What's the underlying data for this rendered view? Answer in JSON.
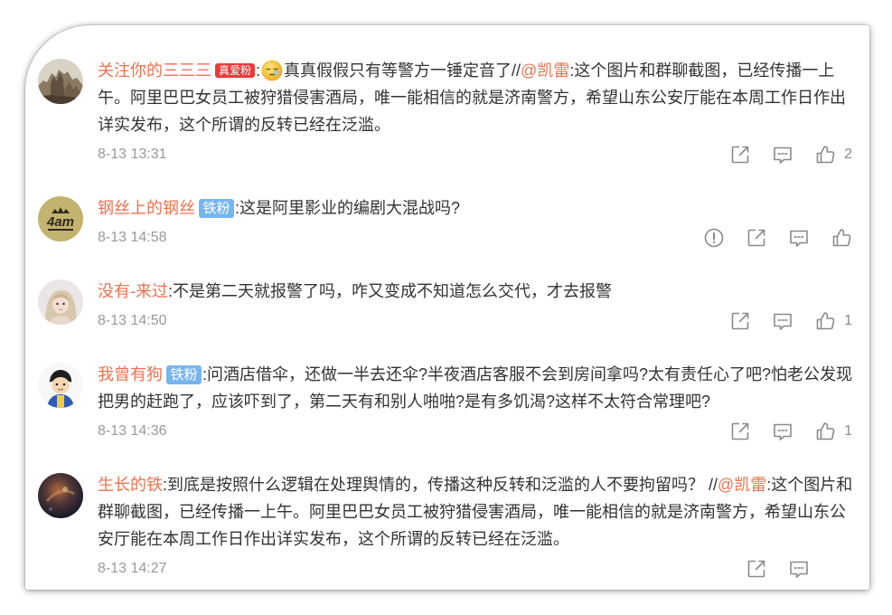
{
  "colors": {
    "background": "#ffffff",
    "username": "#eb7350",
    "mention": "#eb7350",
    "text": "#333333",
    "time": "#999999",
    "icon": "#8a8a8a",
    "badge_love": "#ea3a3a",
    "badge_iron": "#77b5ef"
  },
  "comments": [
    {
      "username": "关注你的三三三",
      "badge": "真爱粉",
      "separator": ":",
      "emoji": "sleepy-face-emoji",
      "text": "真真假假只有等警方一锤定音了//",
      "mention": "@凯雷",
      "quoted": ":这个图片和群聊截图，已经传播一上午。阿里巴巴女员工被狩猎侵害酒局，唯一能相信的就是济南警方，希望山东公安厅能在本周工作日作出详实发布，这个所谓的反转已经在泛滥。",
      "time": "8-13 13:31",
      "actions": [
        "share-icon",
        "comment-icon",
        "thumbs-up-icon"
      ],
      "like_count": "2"
    },
    {
      "username": "钢丝上的钢丝",
      "avatar_logo": "4am",
      "badge": "铁粉",
      "text": ":这是阿里影业的编剧大混战吗?",
      "time": "8-13 14:58",
      "actions": [
        "report-icon",
        "share-icon",
        "comment-icon",
        "thumbs-up-icon"
      ]
    },
    {
      "username": "没有-来过",
      "text": ":不是第二天就报警了吗，咋又变成不知道怎么交代，才去报警",
      "time": "8-13 14:50",
      "actions": [
        "share-icon",
        "comment-icon",
        "thumbs-up-icon"
      ],
      "like_count": "1"
    },
    {
      "username": "我曾有狗",
      "badge": "铁粉",
      "text": ":问酒店借伞，还做一半去还伞?半夜酒店客服不会到房间拿吗?太有责任心了吧?怕老公发现把男的赶跑了，应该吓到了，第二天有和别人啪啪?是有多饥渴?这样不太符合常理吧?",
      "time": "8-13 14:36",
      "actions": [
        "share-icon",
        "comment-icon",
        "thumbs-up-icon"
      ],
      "like_count": "1"
    },
    {
      "username": "生长的铁",
      "text": ":到底是按照什么逻辑在处理舆情的，传播这种反转和泛滥的人不要拘留吗？ //",
      "mention": "@凯雷",
      "quoted": ":这个图片和群聊截图，已经传播一上午。阿里巴巴女员工被狩猎侵害酒局，唯一能相信的就是济南警方，希望山东公安厅能在本周工作日作出详实发布，这个所谓的反转已经在泛滥。",
      "time": "8-13 14:27",
      "actions": [
        "share-icon",
        "comment-icon"
      ]
    }
  ]
}
